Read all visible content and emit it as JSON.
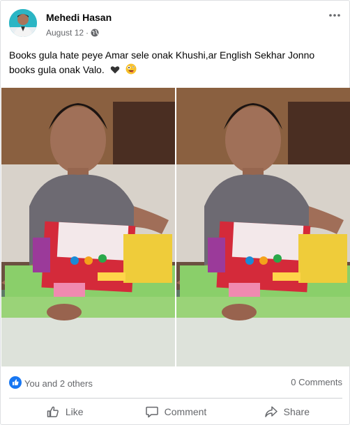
{
  "post": {
    "author": "Mehedi Hasan",
    "date": "August 12",
    "separator": "·",
    "privacy_icon": "globe-icon",
    "text": "Books gula hate peye Amar sele onak Khushi,ar English Sekhar Jonno books gula onak Valo.",
    "emojis": [
      "black-heart-icon",
      "zany-face-icon"
    ]
  },
  "stats": {
    "reaction_icon": "thumbs-up-icon",
    "likes_text": "You and 2 others",
    "comments_text": "0 Comments"
  },
  "actions": {
    "like": "Like",
    "comment": "Comment",
    "share": "Share"
  },
  "colors": {
    "accent": "#1877f2",
    "secondary_text": "#65676b",
    "divider": "#ced0d4"
  }
}
